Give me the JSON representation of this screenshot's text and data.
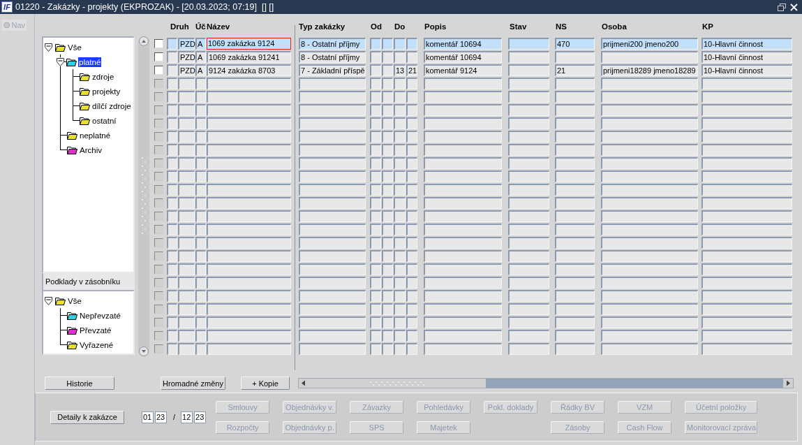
{
  "window": {
    "logo": "IF",
    "title": "01220 - Zakázky - projekty (EKPROZAK) - [20.03.2023; 07:19]  [] []"
  },
  "nav": {
    "label": "Nav",
    "disabled": true
  },
  "tree": [
    {
      "label": "Vše",
      "color": "#e8e030",
      "expanded": true,
      "selected": false,
      "children": [
        {
          "label": "platné",
          "color": "#30d0e0",
          "expanded": true,
          "selected": true,
          "children": [
            {
              "label": "zdroje",
              "color": "#e8e030",
              "selected": false
            },
            {
              "label": "projekty",
              "color": "#e8e030",
              "selected": false
            },
            {
              "label": "dílčí zdroje",
              "color": "#e8e030",
              "selected": false
            },
            {
              "label": "ostatní",
              "color": "#e8e030",
              "selected": false
            }
          ]
        },
        {
          "label": "neplatné",
          "color": "#e8e030",
          "selected": false
        },
        {
          "label": "Archiv",
          "color": "#e030d0",
          "selected": false
        }
      ]
    }
  ],
  "stack_panel": {
    "title": "Podklady v zásobníku",
    "tree": [
      {
        "label": "Vše",
        "color": "#e8e030",
        "expanded": true,
        "selected": false,
        "children": [
          {
            "label": "Nepřevzaté",
            "color": "#30d0e0",
            "selected": false
          },
          {
            "label": "Převzaté",
            "color": "#e030d0",
            "selected": false
          },
          {
            "label": "Vyřazené",
            "color": "#e8e030",
            "selected": false
          }
        ]
      }
    ]
  },
  "table": {
    "columns": [
      "Druh",
      "Úč",
      "Název",
      "Typ zakázky",
      "Od",
      "Do",
      "Popis",
      "Stav",
      "NS",
      "Osoba",
      "KP"
    ],
    "rows": [
      {
        "checked": false,
        "selected": true,
        "focused": true,
        "druh": "PZD",
        "uc": "A",
        "nazev": "1069 zakázka 9124",
        "typ": "8 - Ostatní příjmy",
        "popis": "komentář 10694",
        "ns": "470",
        "osoba": "prijmeni200 jmeno200",
        "kp": "10-Hlavní činnost"
      },
      {
        "checked": false,
        "selected": false,
        "focused": false,
        "druh": "PZD",
        "uc": "A",
        "nazev": "1069 zakázka 91241",
        "typ": "8 - Ostatní příjmy",
        "popis": "komentář 10694",
        "kp": "10-Hlavní činnost"
      },
      {
        "checked": false,
        "selected": false,
        "focused": false,
        "druh": "PZD",
        "uc": "A",
        "nazev": "9124 zakázka 8703",
        "typ": "7 - Základní příspě",
        "do_1": "13",
        "do_2": "21",
        "popis": "komentář 9124",
        "ns": "21",
        "osoba": "prijmeni18289 jmeno18289",
        "kp": "10-Hlavní činnost"
      },
      {
        "disabled": true
      },
      {
        "disabled": true
      },
      {
        "disabled": true
      },
      {
        "disabled": true
      },
      {
        "disabled": true
      },
      {
        "disabled": true
      },
      {
        "disabled": true
      },
      {
        "disabled": true
      },
      {
        "disabled": true
      },
      {
        "disabled": true
      },
      {
        "disabled": true
      },
      {
        "disabled": true
      },
      {
        "disabled": true
      },
      {
        "disabled": true
      },
      {
        "disabled": true
      },
      {
        "disabled": true
      },
      {
        "disabled": true
      },
      {
        "disabled": true
      },
      {
        "disabled": true
      },
      {
        "disabled": true
      },
      {
        "disabled": true
      }
    ]
  },
  "actions": [
    {
      "label": "Historie"
    },
    {
      "label": "Hromadné změny"
    },
    {
      "label": "+ Kopie"
    }
  ],
  "detail_button": "Detaily k zakázce",
  "period": {
    "from": [
      "01",
      "23"
    ],
    "separator": "/",
    "to": [
      "12",
      "23"
    ]
  },
  "buttons_row_1": [
    {
      "label": "Smlouvy",
      "disabled": true
    },
    {
      "label": "Objednávky v.",
      "disabled": true
    },
    {
      "label": "Závazky",
      "disabled": true
    },
    {
      "label": "Pohledávky",
      "disabled": true
    },
    {
      "label": "Pokl. doklady",
      "disabled": true
    },
    {
      "label": "Řádky BV",
      "disabled": true
    },
    {
      "label": "VZM",
      "disabled": true
    },
    {
      "label": "Účetní položky",
      "disabled": true
    }
  ],
  "buttons_row_2": [
    {
      "label": "Rozpočty",
      "disabled": true
    },
    {
      "label": "Objednávky p.",
      "disabled": true
    },
    {
      "label": "SPS",
      "disabled": true
    },
    {
      "label": "Majetek",
      "disabled": true
    },
    {
      "label": "Zásoby",
      "disabled": true
    },
    {
      "label": "Cash Flow",
      "disabled": true
    },
    {
      "label": "Monitorovací zpráva",
      "disabled": true
    }
  ]
}
